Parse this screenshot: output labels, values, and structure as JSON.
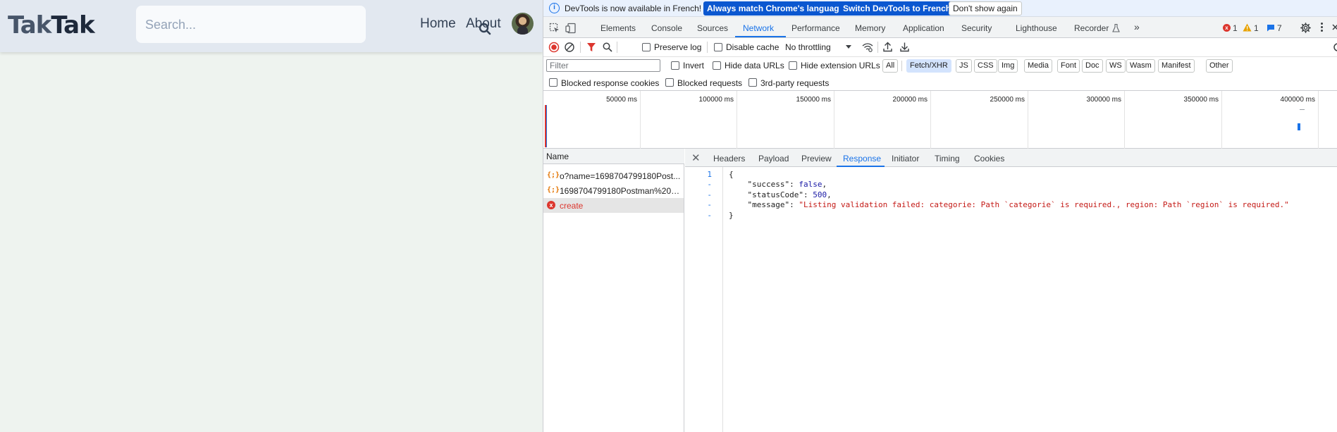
{
  "site": {
    "logo_part1": "Tak",
    "logo_part2": "Tak",
    "search_placeholder": "Search...",
    "nav": {
      "home": "Home",
      "about": "About"
    }
  },
  "devtools": {
    "infobar": {
      "text": "DevTools is now available in French!",
      "btn_match": "Always match Chrome's language",
      "btn_switch": "Switch DevTools to French",
      "btn_dismiss": "Don't show again"
    },
    "tabs": [
      "Elements",
      "Console",
      "Sources",
      "Network",
      "Performance",
      "Memory",
      "Application",
      "Security",
      "Lighthouse",
      "Recorder"
    ],
    "active_tab": "Network",
    "more_tabs": "»",
    "counts": {
      "errors": "1",
      "warnings": "1",
      "messages": "7"
    },
    "network_toolbar": {
      "preserve_log": "Preserve log",
      "disable_cache": "Disable cache",
      "throttling": "No throttling"
    },
    "filter_row": {
      "filter_placeholder": "Filter",
      "invert": "Invert",
      "hide_data_urls": "Hide data URLs",
      "hide_extension_urls": "Hide extension URLs",
      "chips": [
        "All",
        "Fetch/XHR",
        "JS",
        "CSS",
        "Img",
        "Media",
        "Font",
        "Doc",
        "WS",
        "Wasm",
        "Manifest",
        "Other"
      ],
      "active_chip": "Fetch/XHR"
    },
    "blocked_row": {
      "blocked_cookies": "Blocked response cookies",
      "blocked_requests": "Blocked requests",
      "third_party": "3rd-party requests"
    },
    "timeline_ticks": [
      "50000 ms",
      "100000 ms",
      "150000 ms",
      "200000 ms",
      "250000 ms",
      "300000 ms",
      "350000 ms",
      "400000 ms"
    ],
    "requests": {
      "header": "Name",
      "rows": [
        {
          "icon": "{;}",
          "name": "o?name=1698704799180Post...",
          "status": "ok"
        },
        {
          "icon": "{;}",
          "name": "1698704799180Postman%20A...",
          "status": "ok"
        },
        {
          "icon": "x",
          "name": "create",
          "status": "error"
        }
      ]
    },
    "detail_tabs": [
      "Headers",
      "Payload",
      "Preview",
      "Response",
      "Initiator",
      "Timing",
      "Cookies"
    ],
    "active_detail_tab": "Response",
    "response": {
      "line_numbers": [
        "1",
        "-",
        "-",
        "-",
        "-"
      ],
      "open_brace": "{",
      "close_brace": "}",
      "key_success": "\"success\"",
      "val_success": "false",
      "key_status": "\"statusCode\"",
      "val_status": "500",
      "key_message": "\"message\"",
      "val_message": "\"Listing validation failed: categorie: Path `categorie` is required., region: Path `region` is required.\""
    }
  }
}
